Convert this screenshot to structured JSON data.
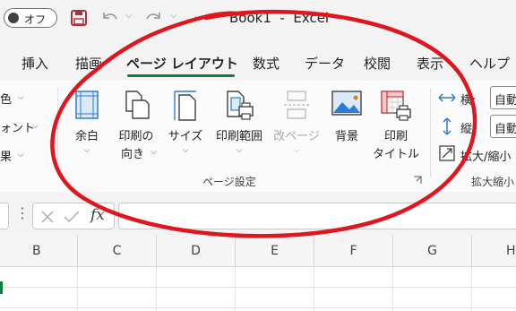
{
  "titlebar": {
    "autosave_label": "オフ",
    "doc_title": "Book1  -  Excel",
    "icons": [
      "save-icon",
      "undo-icon",
      "redo-icon"
    ]
  },
  "tabs": [
    {
      "label": "挿入"
    },
    {
      "label": "描画"
    },
    {
      "label": "ページ レイアウト",
      "active": true
    },
    {
      "label": "数式"
    },
    {
      "label": "データ"
    },
    {
      "label": "校閲"
    },
    {
      "label": "表示"
    },
    {
      "label": "ヘルプ"
    }
  ],
  "ribbon": {
    "theme_partial": {
      "colors": "色",
      "fonts": "ォント",
      "effects": "果"
    },
    "page_setup": {
      "group_label": "ページ設定",
      "buttons": [
        {
          "l1": "余白",
          "l2": "",
          "icon": "margins-icon"
        },
        {
          "l1": "印刷の",
          "l2": "向き",
          "icon": "orientation-icon"
        },
        {
          "l1": "サイズ",
          "l2": "",
          "icon": "size-icon"
        },
        {
          "l1": "印刷範囲",
          "l2": "",
          "icon": "print-area-icon"
        },
        {
          "l1": "改ページ",
          "l2": "",
          "icon": "breaks-icon",
          "disabled": true
        },
        {
          "l1": "背景",
          "l2": "",
          "icon": "background-icon"
        },
        {
          "l1": "印刷",
          "l2": "タイトル",
          "icon": "print-titles-icon"
        }
      ]
    },
    "scale": {
      "width_label": "横:",
      "height_label": "縦:",
      "width_value": "自動",
      "height_value": "自動",
      "scale_label": "拡大/縮小",
      "group_label": "拡大縮小"
    }
  },
  "formula_bar": {
    "fx_label": "fx"
  },
  "columns": [
    "B",
    "C",
    "D",
    "E",
    "F",
    "G",
    "H"
  ],
  "colors": {
    "accent": "#107c41",
    "annotation": "#e0161e",
    "save": "#a4373a"
  }
}
